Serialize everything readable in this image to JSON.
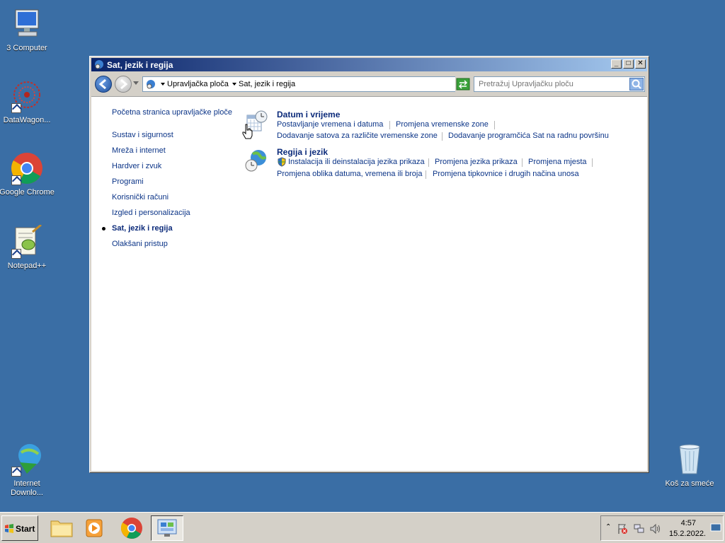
{
  "desktop": {
    "icons": [
      {
        "label": "3 Computer"
      },
      {
        "label": "DataWagon..."
      },
      {
        "label": "Google Chrome"
      },
      {
        "label": "Notepad++"
      },
      {
        "label": "Internet Downlo..."
      },
      {
        "label": "Koš za smeće"
      }
    ]
  },
  "window": {
    "title": "Sat, jezik i regija",
    "breadcrumb": [
      "Upravljačka ploča",
      "Sat, jezik i regija"
    ],
    "search_placeholder": "Pretražuj Upravljačku ploču",
    "left_nav": [
      {
        "label": "Početna stranica upravljačke ploče"
      },
      {
        "label": "Sustav i sigurnost"
      },
      {
        "label": "Mreža i internet"
      },
      {
        "label": "Hardver i zvuk"
      },
      {
        "label": "Programi"
      },
      {
        "label": "Korisnički računi"
      },
      {
        "label": "Izgled i personalizacija"
      },
      {
        "label": "Sat, jezik i regija"
      },
      {
        "label": "Olakšani pristup"
      }
    ],
    "categories": [
      {
        "title": "Datum i vrijeme",
        "links": [
          "Postavljanje vremena i datuma",
          "Promjena vremenske zone",
          "Dodavanje satova za različite vremenske zone",
          "Dodavanje programčića Sat na radnu površinu"
        ]
      },
      {
        "title": "Regija i jezik",
        "links": [
          "Instalacija ili deinstalacija jezika prikaza",
          "Promjena jezika prikaza",
          "Promjena mjesta",
          "Promjena oblika datuma, vremena ili broja",
          "Promjena tipkovnice i drugih načina unosa"
        ]
      }
    ]
  },
  "taskbar": {
    "start_label": "Start",
    "clock_time": "4:57",
    "clock_date": "15.2.2022."
  }
}
